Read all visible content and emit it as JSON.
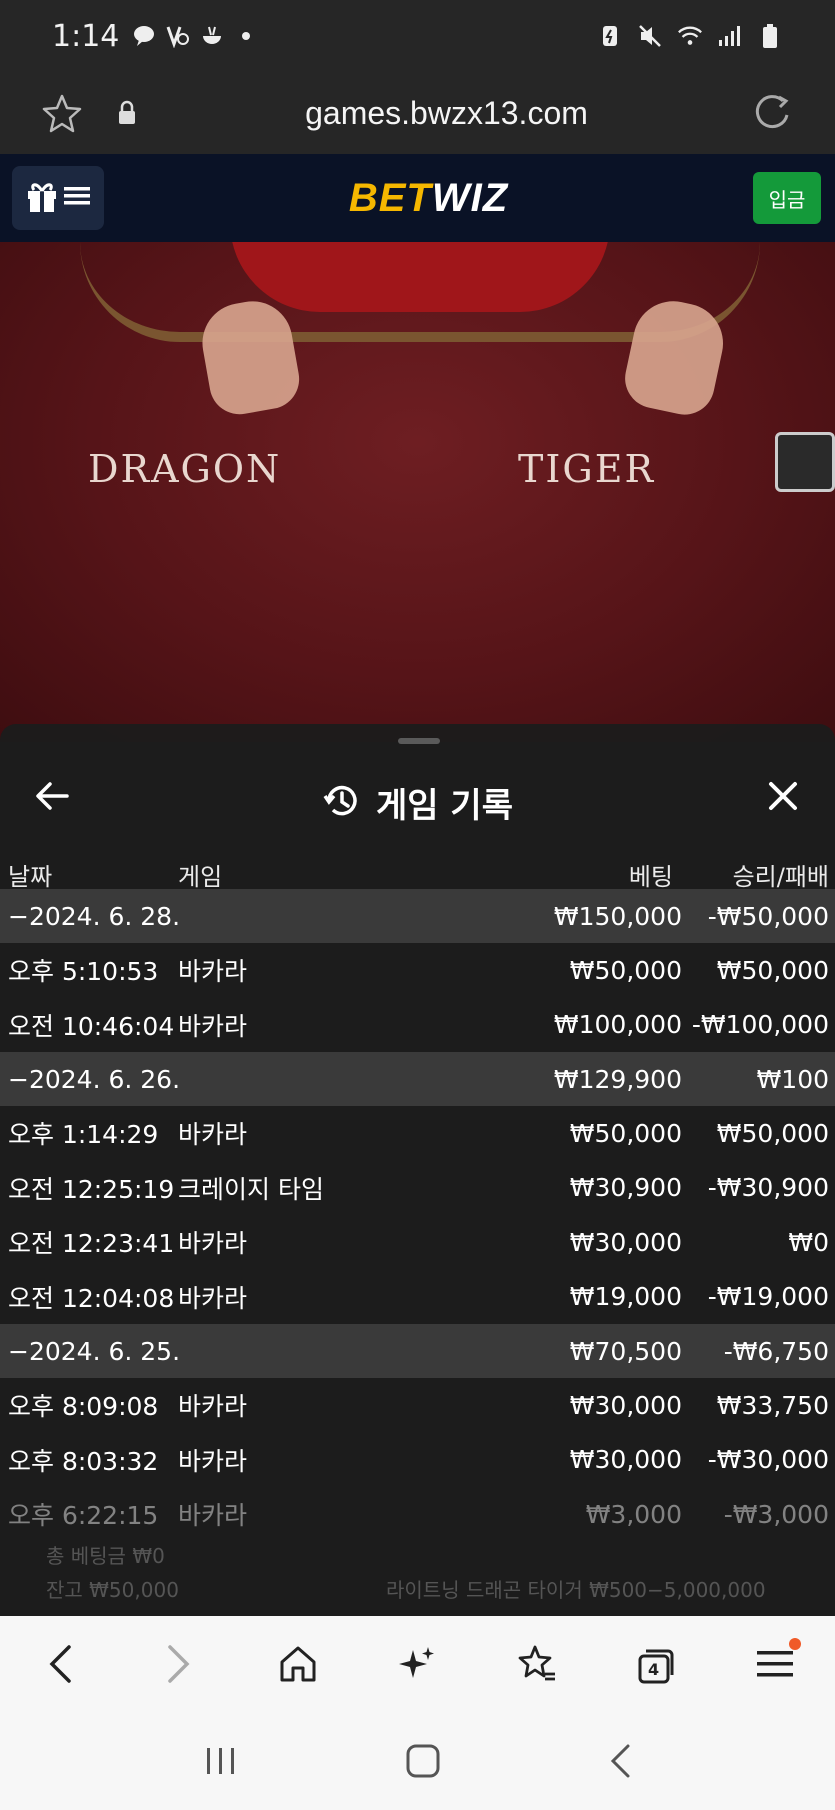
{
  "status_bar": {
    "time": "1:14"
  },
  "url_bar": {
    "url": "games.bwzx13.com"
  },
  "site_header": {
    "logo_part1": "BET",
    "logo_part2": "WIZ",
    "deposit_label": "입금"
  },
  "video": {
    "label_left": "DRAGON",
    "label_right": "TIGER"
  },
  "sheet": {
    "title": "게임 기록",
    "columns": [
      "날짜",
      "게임",
      "베팅",
      "승리/패배"
    ],
    "rows": [
      {
        "type": "date",
        "date": "−2024. 6. 28.",
        "bet": "₩150,000",
        "win": "-₩50,000"
      },
      {
        "type": "item",
        "date": "오후 5:10:53",
        "game": "바카라",
        "bet": "₩50,000",
        "win": "₩50,000"
      },
      {
        "type": "item",
        "date": "오전 10:46:04",
        "game": "바카라",
        "bet": "₩100,000",
        "win": "-₩100,000"
      },
      {
        "type": "date",
        "date": "−2024. 6. 26.",
        "bet": "₩129,900",
        "win": "₩100"
      },
      {
        "type": "item",
        "date": "오후 1:14:29",
        "game": "바카라",
        "bet": "₩50,000",
        "win": "₩50,000"
      },
      {
        "type": "item",
        "date": "오전 12:25:19",
        "game": "크레이지 타임",
        "bet": "₩30,900",
        "win": "-₩30,900"
      },
      {
        "type": "item",
        "date": "오전 12:23:41",
        "game": "바카라",
        "bet": "₩30,000",
        "win": "₩0"
      },
      {
        "type": "item",
        "date": "오전 12:04:08",
        "game": "바카라",
        "bet": "₩19,000",
        "win": "-₩19,000"
      },
      {
        "type": "date",
        "date": "−2024. 6. 25.",
        "bet": "₩70,500",
        "win": "-₩6,750"
      },
      {
        "type": "item",
        "date": "오후 8:09:08",
        "game": "바카라",
        "bet": "₩30,000",
        "win": "₩33,750"
      },
      {
        "type": "item",
        "date": "오후 8:03:32",
        "game": "바카라",
        "bet": "₩30,000",
        "win": "-₩30,000"
      },
      {
        "type": "item",
        "date": "오후 6:22:15",
        "game": "바카라",
        "bet": "₩3,000",
        "win": "-₩3,000"
      }
    ],
    "footer_total": "총 베팅금 ₩0",
    "footer_balance": "잔고 ₩50,000",
    "footer_limits": "라이트닝 드래곤 타이거 ₩500−5,000,000"
  },
  "bottom_nav": {
    "tabs_count": "4",
    "items": [
      "back-icon",
      "forward-icon",
      "home-icon",
      "sparkle-icon",
      "bookmarks-icon",
      "tabs-icon",
      "menu-icon"
    ]
  },
  "colors": {
    "accent_green": "#149a3a",
    "logo_yellow": "#f5b700",
    "header_navy": "#0a1226",
    "notification_orange": "#f05a28"
  }
}
